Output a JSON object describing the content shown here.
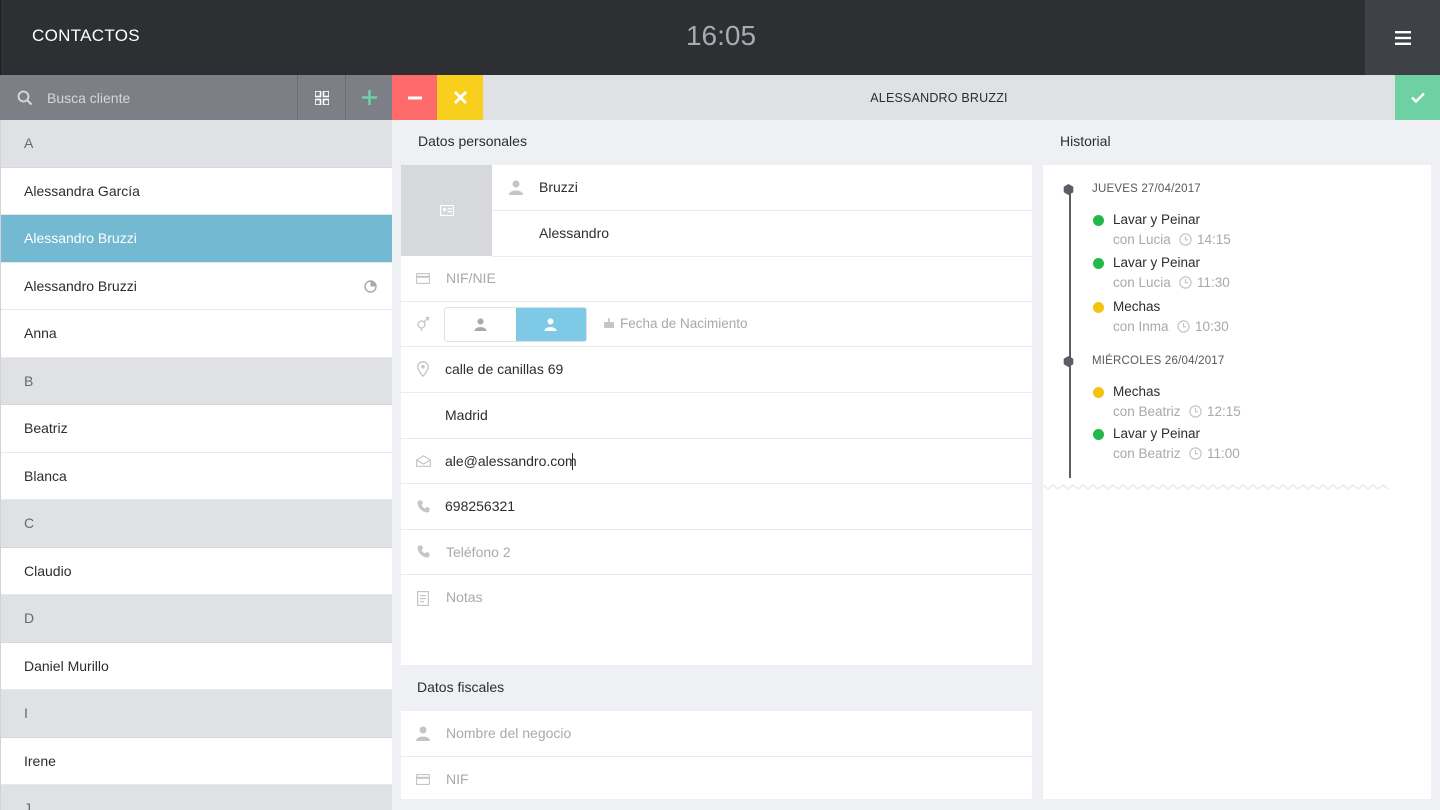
{
  "header": {
    "title": "CONTACTOS",
    "time": "16:05"
  },
  "search": {
    "placeholder": "Busca cliente"
  },
  "detail": {
    "title": "ALESSANDRO BRUZZI"
  },
  "contacts": [
    {
      "type": "header",
      "label": "A"
    },
    {
      "type": "item",
      "label": "Alessandra García"
    },
    {
      "type": "item",
      "label": "Alessandro Bruzzi",
      "selected": true
    },
    {
      "type": "item",
      "label": "Alessandro Bruzzi",
      "badge": true
    },
    {
      "type": "item",
      "label": "Anna"
    },
    {
      "type": "header",
      "label": "B"
    },
    {
      "type": "item",
      "label": "Beatriz"
    },
    {
      "type": "item",
      "label": "Blanca"
    },
    {
      "type": "header",
      "label": "C"
    },
    {
      "type": "item",
      "label": "Claudio"
    },
    {
      "type": "header",
      "label": "D"
    },
    {
      "type": "item",
      "label": "Daniel Murillo"
    },
    {
      "type": "header",
      "label": "I"
    },
    {
      "type": "item",
      "label": "Irene"
    },
    {
      "type": "header",
      "label": "J"
    }
  ],
  "personal": {
    "section_title": "Datos personales",
    "surname": "Bruzzi",
    "name": "Alessandro",
    "nif_placeholder": "NIF/NIE",
    "birth_placeholder": "Fecha de Nacimiento",
    "address": "calle de canillas 69",
    "city": "Madrid",
    "email": "ale@alessandro.com",
    "phone": "698256321",
    "phone2_placeholder": "Teléfono 2",
    "notes_placeholder": "Notas"
  },
  "fiscal": {
    "section_title": "Datos fiscales",
    "business_placeholder": "Nombre del negocio",
    "nif_placeholder": "NIF"
  },
  "history": {
    "section_title": "Historial",
    "days": [
      {
        "label": "JUEVES 27/04/2017",
        "appointments": [
          {
            "service": "Lavar y Peinar",
            "who": "con Lucia",
            "time": "14:15",
            "status": "green"
          },
          {
            "service": "Lavar y Peinar",
            "who": "con Lucia",
            "time": "11:30",
            "status": "green"
          },
          {
            "service": "Mechas",
            "who": "con Inma",
            "time": "10:30",
            "status": "yellow"
          }
        ]
      },
      {
        "label": "MIÉRCOLES 26/04/2017",
        "appointments": [
          {
            "service": "Mechas",
            "who": "con Beatriz",
            "time": "12:15",
            "status": "yellow"
          },
          {
            "service": "Lavar y Peinar",
            "who": "con Beatriz",
            "time": "11:00",
            "status": "green"
          }
        ]
      }
    ]
  },
  "colors": {
    "green": "#22b84a",
    "yellow": "#f2c30f",
    "accent": "#73b9d2",
    "minus": "#ff6b6b",
    "close": "#f7cf1c",
    "confirm": "#6ed1a4"
  }
}
